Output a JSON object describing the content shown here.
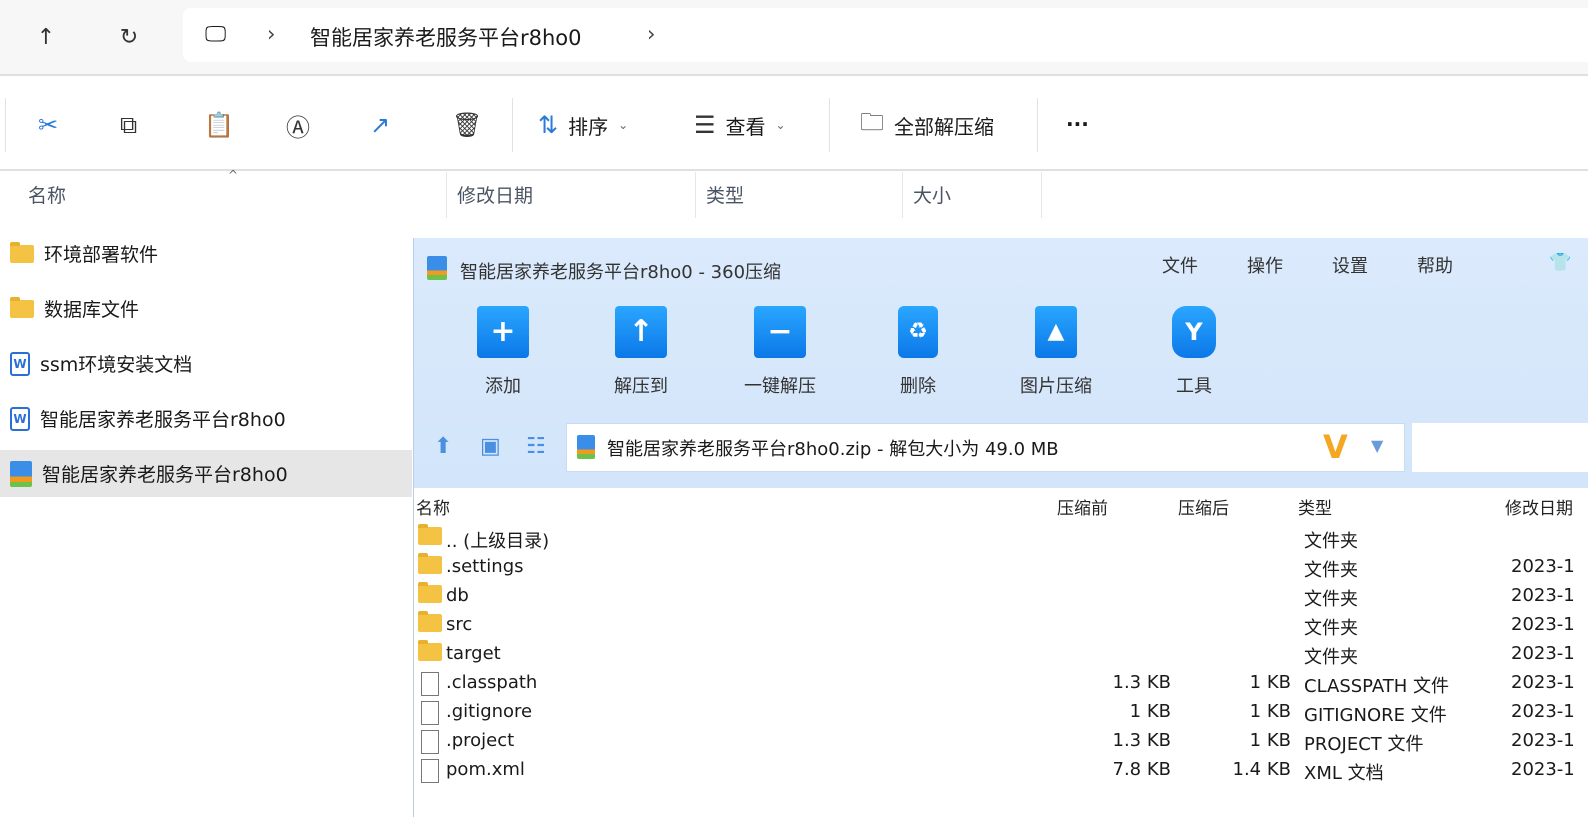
{
  "explorer": {
    "breadcrumb": [
      "智能居家养老服务平台r8ho0"
    ],
    "toolbar": {
      "sort": "排序",
      "view": "查看",
      "extract_all": "全部解压缩",
      "more": "..."
    },
    "columns": [
      "名称",
      "修改日期",
      "类型",
      "大小"
    ],
    "items": [
      {
        "name": "环境部署软件",
        "icon": "folder-icon"
      },
      {
        "name": "数据库文件",
        "icon": "folder-icon"
      },
      {
        "name": "ssm环境安装文档",
        "icon": "word-doc-icon"
      },
      {
        "name": "智能居家养老服务平台r8ho0",
        "icon": "word-doc-icon"
      },
      {
        "name": "智能居家养老服务平台r8ho0",
        "icon": "zip-icon",
        "selected": true
      }
    ]
  },
  "zip": {
    "title": "智能居家养老服务平台r8ho0 - 360压缩",
    "menu": [
      "文件",
      "操作",
      "设置",
      "帮助"
    ],
    "buttons": [
      "添加",
      "解压到",
      "一键解压",
      "删除",
      "图片压缩",
      "工具"
    ],
    "path": "智能居家养老服务平台r8ho0.zip - 解包大小为 49.0 MB",
    "columns": [
      "名称",
      "压缩前",
      "压缩后",
      "类型",
      "修改日期"
    ],
    "rows": [
      {
        "name": ".. (上级目录)",
        "before": "",
        "after": "",
        "type": "文件夹",
        "date": "",
        "folder": true
      },
      {
        "name": ".settings",
        "before": "",
        "after": "",
        "type": "文件夹",
        "date": "2023-1",
        "folder": true
      },
      {
        "name": "db",
        "before": "",
        "after": "",
        "type": "文件夹",
        "date": "2023-1",
        "folder": true
      },
      {
        "name": "src",
        "before": "",
        "after": "",
        "type": "文件夹",
        "date": "2023-1",
        "folder": true
      },
      {
        "name": "target",
        "before": "",
        "after": "",
        "type": "文件夹",
        "date": "2023-1",
        "folder": true
      },
      {
        "name": ".classpath",
        "before": "1.3 KB",
        "after": "1 KB",
        "type": "CLASSPATH 文件",
        "date": "2023-1",
        "folder": false
      },
      {
        "name": ".gitignore",
        "before": "1 KB",
        "after": "1 KB",
        "type": "GITIGNORE 文件",
        "date": "2023-1",
        "folder": false
      },
      {
        "name": ".project",
        "before": "1.3 KB",
        "after": "1 KB",
        "type": "PROJECT 文件",
        "date": "2023-1",
        "folder": false
      },
      {
        "name": "pom.xml",
        "before": "7.8 KB",
        "after": "1.4 KB",
        "type": "XML 文档",
        "date": "2023-1",
        "folder": false
      }
    ]
  }
}
